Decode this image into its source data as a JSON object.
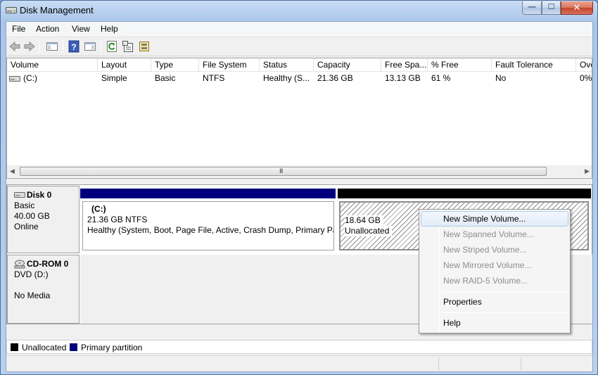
{
  "window": {
    "title": "Disk Management"
  },
  "menubar": {
    "items": [
      "File",
      "Action",
      "View",
      "Help"
    ]
  },
  "toolbar": {
    "icons": [
      "back-icon",
      "forward-icon",
      "show-hide-console-tree-icon",
      "help-icon",
      "show-hide-action-pane-icon",
      "refresh-icon",
      "properties-icon",
      "disk-icon"
    ]
  },
  "volume_list": {
    "columns": [
      "Volume",
      "Layout",
      "Type",
      "File System",
      "Status",
      "Capacity",
      "Free Spa...",
      "% Free",
      "Fault Tolerance",
      "Ove"
    ],
    "rows": [
      {
        "volume": "(C:)",
        "layout": "Simple",
        "type": "Basic",
        "file_system": "NTFS",
        "status": "Healthy (S...",
        "capacity": "21.36 GB",
        "free_space": "13.13 GB",
        "percent_free": "61 %",
        "fault_tolerance": "No",
        "overhead": "0%"
      }
    ],
    "scroll_grip": "III"
  },
  "disks": [
    {
      "name": "Disk 0",
      "type": "Basic",
      "size": "40.00 GB",
      "status": "Online",
      "partitions": [
        {
          "header_color": "#00007f",
          "title": "(C:)",
          "line1": "21.36 GB NTFS",
          "line2": "Healthy (System, Boot, Page File, Active, Crash Dump, Primary Par"
        },
        {
          "header_color": "#000000",
          "title": "",
          "line1": "18.64 GB",
          "line2": "Unallocated"
        }
      ]
    },
    {
      "name": "CD-ROM 0",
      "type": "DVD (D:)",
      "status": "No Media"
    }
  ],
  "legend": [
    {
      "label": "Unallocated",
      "color": "#000000"
    },
    {
      "label": "Primary partition",
      "color": "#00007f"
    }
  ],
  "context_menu": {
    "items": [
      {
        "label": "New Simple Volume...",
        "enabled": true,
        "highlighted": true
      },
      {
        "label": "New Spanned Volume...",
        "enabled": false
      },
      {
        "label": "New Striped Volume...",
        "enabled": false
      },
      {
        "label": "New Mirrored Volume...",
        "enabled": false
      },
      {
        "label": "New RAID-5 Volume...",
        "enabled": false
      },
      {
        "label": "Properties",
        "enabled": true
      },
      {
        "label": "Help",
        "enabled": true
      }
    ]
  },
  "colors": {
    "primary_partition": "#00007f",
    "unallocated": "#000000",
    "menu_highlight": "#aecbed"
  }
}
